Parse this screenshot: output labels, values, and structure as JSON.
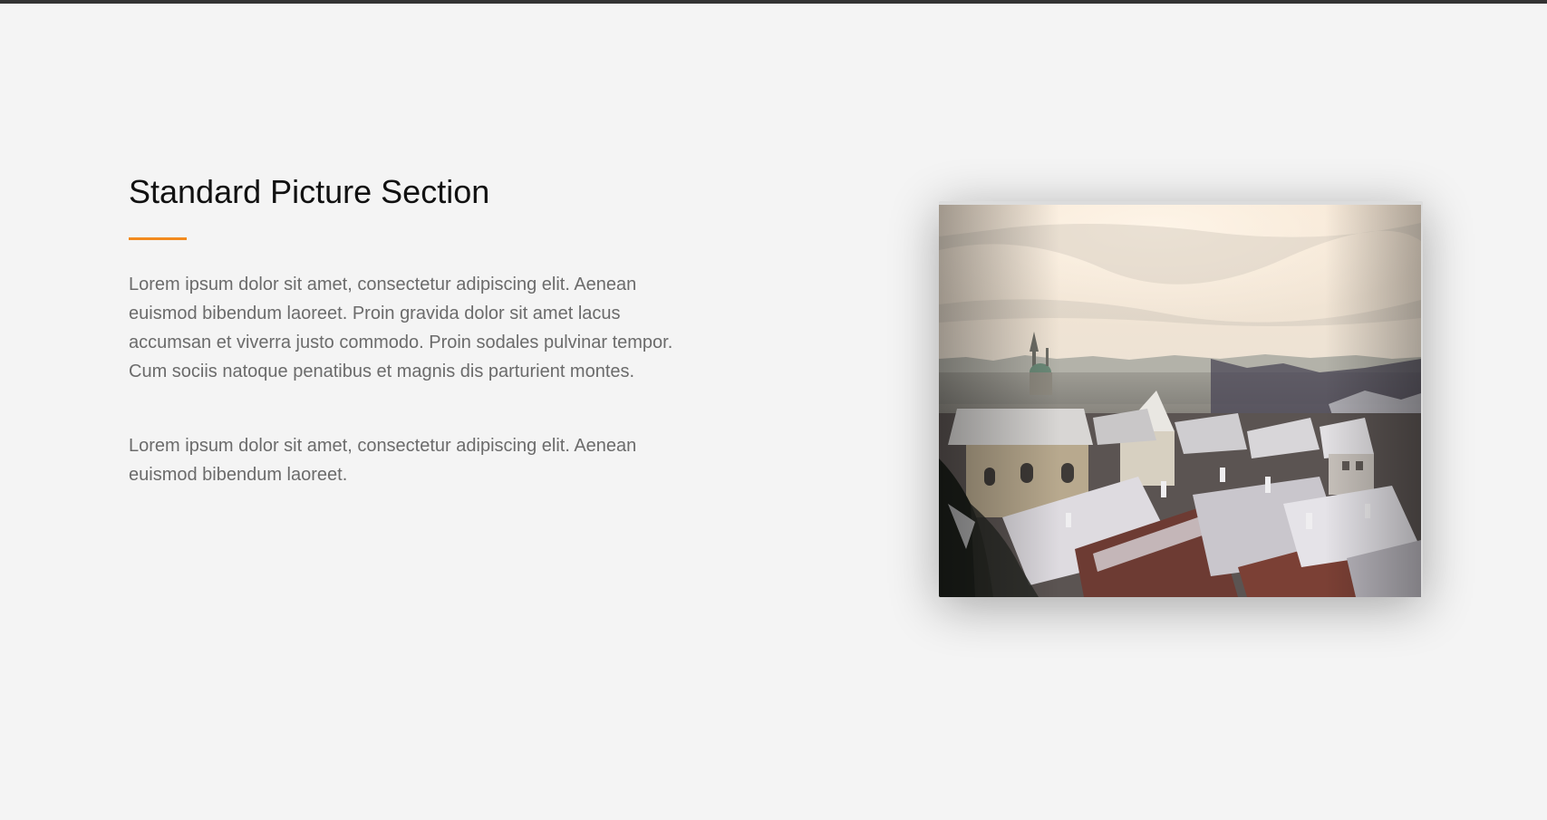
{
  "section": {
    "title": "Standard Picture Section",
    "accent_color": "#f28a1e",
    "paragraphs": [
      "Lorem ipsum dolor sit amet, consectetur adipiscing elit. Aenean euismod bibendum laoreet. Proin gravida dolor sit amet lacus accumsan et viverra justo commodo. Proin sodales pulvinar tempor. Cum sociis natoque penatibus et magnis dis parturient montes.",
      "Lorem ipsum dolor sit amet, consectetur adipiscing elit. Aenean euismod bibendum laoreet."
    ]
  }
}
